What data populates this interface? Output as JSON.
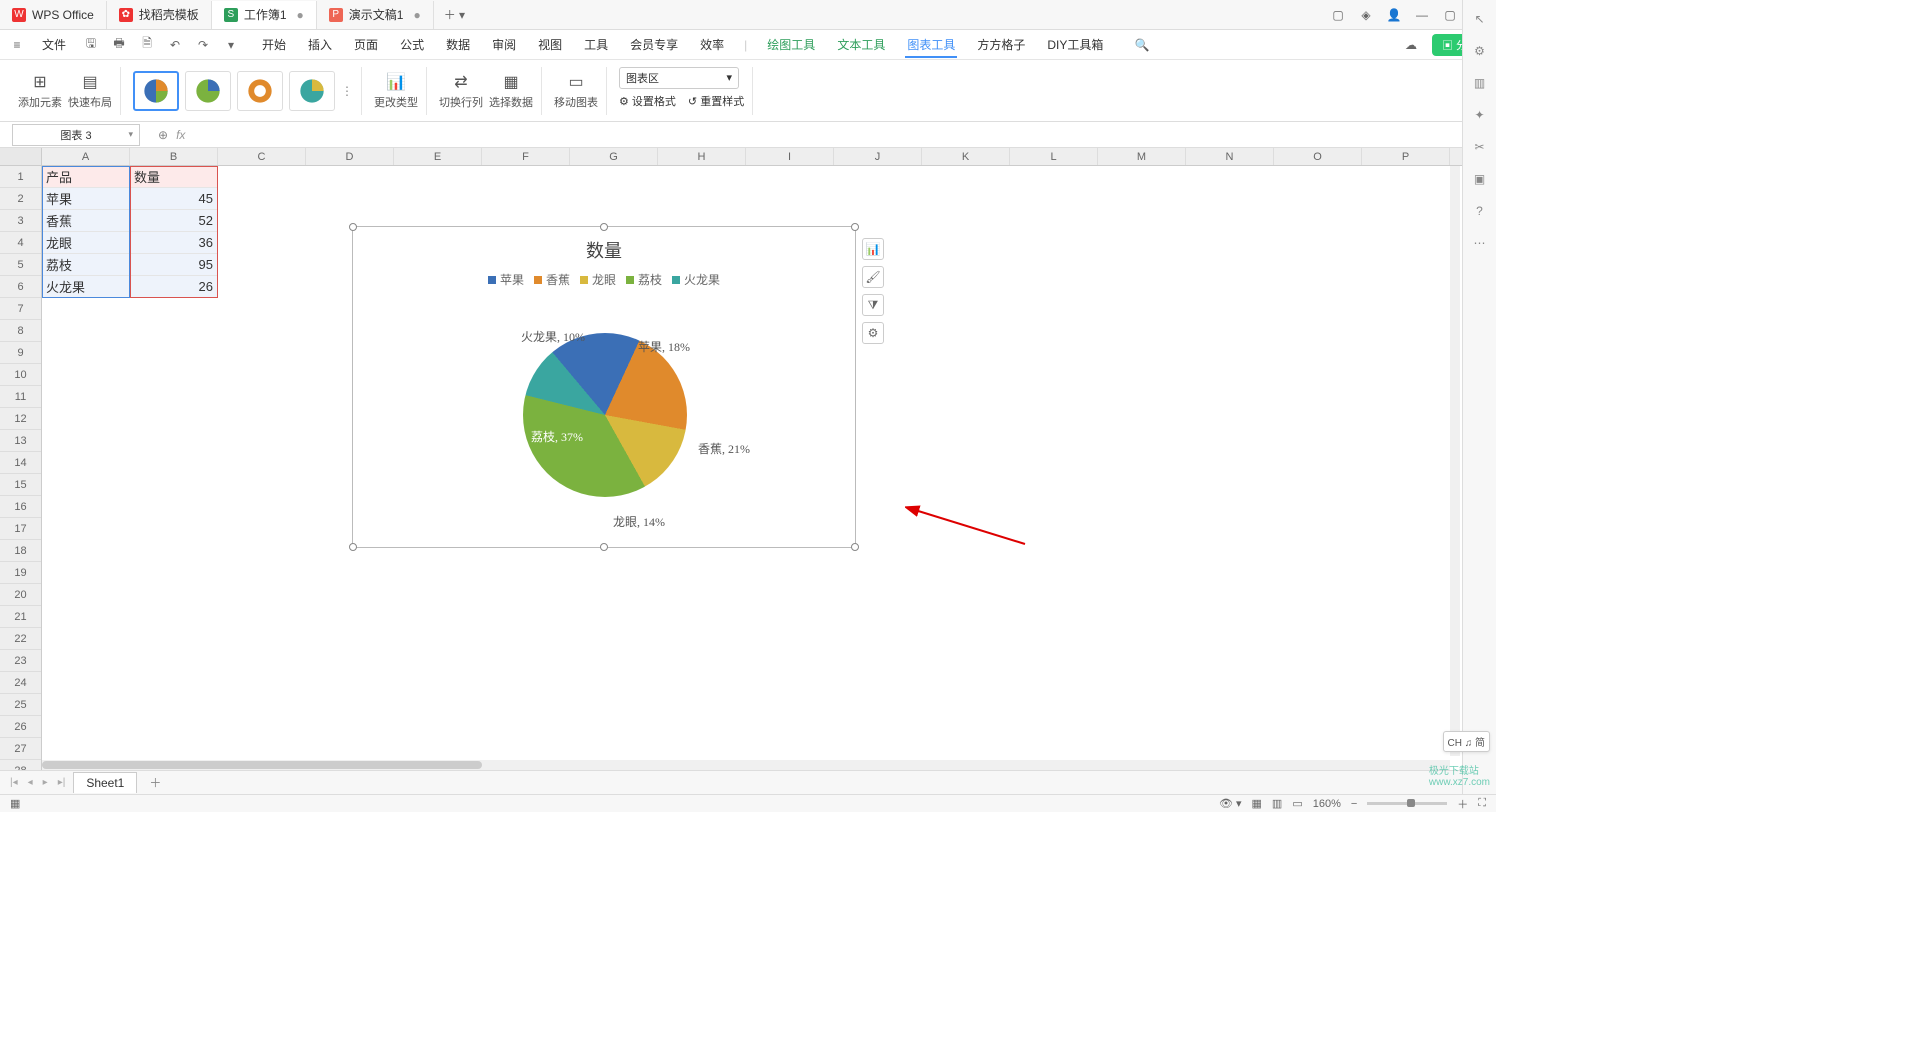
{
  "titlebar": {
    "tabs": [
      {
        "label": "WPS Office",
        "color": "#e33"
      },
      {
        "label": "找稻壳模板",
        "color": "#e33"
      },
      {
        "label": "工作簿1",
        "color": "#2e9e5b",
        "letter": "S",
        "active": true
      },
      {
        "label": "演示文稿1",
        "color": "#e65",
        "letter": "P"
      }
    ]
  },
  "menubar": {
    "file": "文件",
    "tabs": [
      "开始",
      "插入",
      "页面",
      "公式",
      "数据",
      "审阅",
      "视图",
      "工具",
      "会员专享",
      "效率"
    ],
    "tool_tabs": [
      "绘图工具",
      "文本工具",
      "图表工具",
      "方方格子",
      "DIY工具箱"
    ],
    "active_tool": "图表工具",
    "share": "分享"
  },
  "ribbon": {
    "add_element": "添加元素",
    "quick_layout": "快速布局",
    "change_type": "更改类型",
    "switch_rc": "切换行列",
    "select_data": "选择数据",
    "move_chart": "移动图表",
    "area_select": "图表区",
    "set_format": "设置格式",
    "reset_style": "重置样式"
  },
  "name_box": "图表 3",
  "columns": [
    "A",
    "B",
    "C",
    "D",
    "E",
    "F",
    "G",
    "H",
    "I",
    "J",
    "K",
    "L",
    "M",
    "N",
    "O",
    "P"
  ],
  "rows": 28,
  "table": {
    "headers": [
      "产品",
      "数量"
    ],
    "rows": [
      [
        "苹果",
        45
      ],
      [
        "香蕉",
        52
      ],
      [
        "龙眼",
        36
      ],
      [
        "荔枝",
        95
      ],
      [
        "火龙果",
        26
      ]
    ]
  },
  "chart_data": {
    "type": "pie",
    "title": "数量",
    "series_name": "数量",
    "categories": [
      "苹果",
      "香蕉",
      "龙眼",
      "荔枝",
      "火龙果"
    ],
    "values": [
      45,
      52,
      36,
      95,
      26
    ],
    "colors": [
      "#3b6fb6",
      "#e08a2c",
      "#d8b93e",
      "#7bb23f",
      "#3aa6a0"
    ],
    "data_labels": [
      "苹果, 18%",
      "香蕉, 21%",
      "龙眼, 14%",
      "荔枝, 37%",
      "火龙果, 10%"
    ]
  },
  "sheet": {
    "name": "Sheet1"
  },
  "status": {
    "zoom": "160%",
    "ime": "CH ♫ 简"
  },
  "watermark": {
    "brand": "极光下载站",
    "url": "www.xz7.com"
  }
}
